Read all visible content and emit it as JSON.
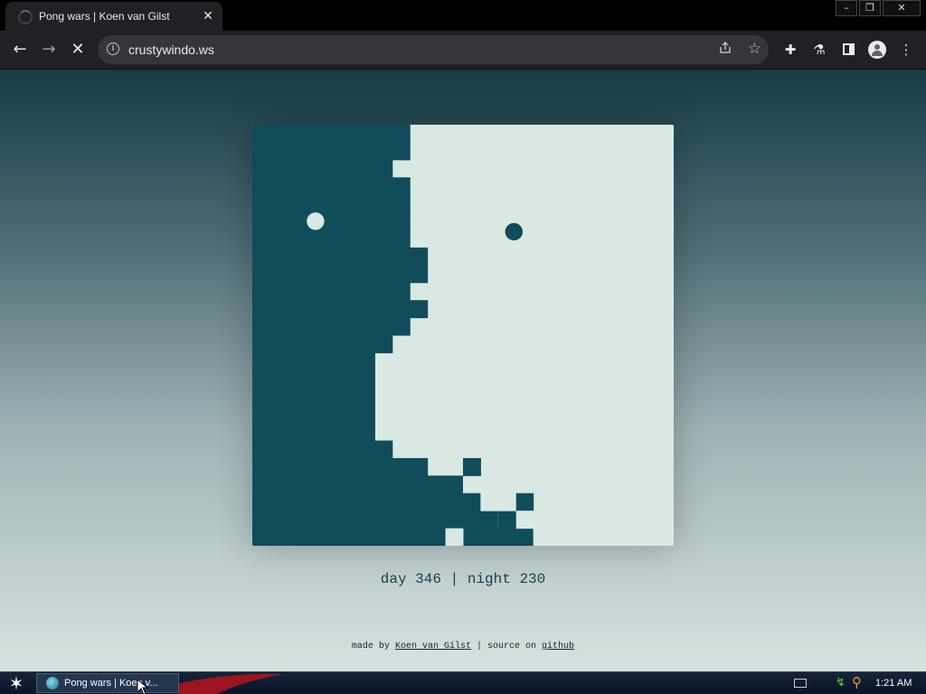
{
  "browser": {
    "tab": {
      "title": "Pong wars | Koen van Gilst",
      "close_glyph": "✕"
    },
    "window_controls": {
      "minimize": "–",
      "restore": "❐",
      "close": "✕"
    },
    "nav": {
      "back": "←",
      "forward": "→",
      "stop": "✕"
    },
    "omnibox": {
      "info_glyph": "i",
      "url": "crustywindo.ws",
      "share_icon": "share-icon",
      "star": "☆"
    },
    "toolbar_icons": [
      "puzzle-icon",
      "flask-icon",
      "side-panel-icon",
      "profile-icon",
      "menu-icon"
    ],
    "menu_glyph": "⋮",
    "ext_glyph": "✚",
    "lab_glyph": "⚗"
  },
  "game": {
    "colors": {
      "day": "#d9e8e3",
      "night": "#114c5a"
    },
    "grid_cols": 24,
    "grid_rows": 24,
    "night_boundary_by_row": [
      9,
      9,
      8,
      9,
      9,
      9,
      9,
      10,
      10,
      9,
      10,
      9,
      8,
      7,
      7,
      7,
      7,
      7,
      8,
      10,
      12,
      13,
      14,
      16
    ],
    "extra_cells": [
      {
        "row": 19,
        "col": 12,
        "owner": "night"
      },
      {
        "row": 21,
        "col": 15,
        "owner": "night"
      },
      {
        "row": 22,
        "col": 15,
        "owner": "day"
      },
      {
        "row": 22,
        "col": 14,
        "owner": "night"
      },
      {
        "row": 21,
        "col": 13,
        "owner": "day"
      },
      {
        "row": 21,
        "col": 14,
        "owner": "day"
      },
      {
        "row": 23,
        "col": 11,
        "owner": "day"
      }
    ],
    "balls": [
      {
        "name": "day-ball",
        "owner": "day",
        "cx_cell": 3.6,
        "cy_cell": 5.5
      },
      {
        "name": "night-ball",
        "owner": "night",
        "cx_cell": 14.9,
        "cy_cell": 6.1
      }
    ],
    "score": {
      "day_label": "day",
      "day_value": "346",
      "separator": "|",
      "night_label": "night",
      "night_value": "230"
    }
  },
  "credits": {
    "made_by_prefix": "made by",
    "author_link": "Koen van Gilst",
    "separator": "|",
    "source_prefix": "source on",
    "source_link": "github"
  },
  "taskbar": {
    "start_glyph": "✶",
    "task_button_label": "Pong wars | Koen v...",
    "clock": "1:21 AM",
    "tray_net_glyph": "↯",
    "tray_search_glyph": "⚲"
  }
}
